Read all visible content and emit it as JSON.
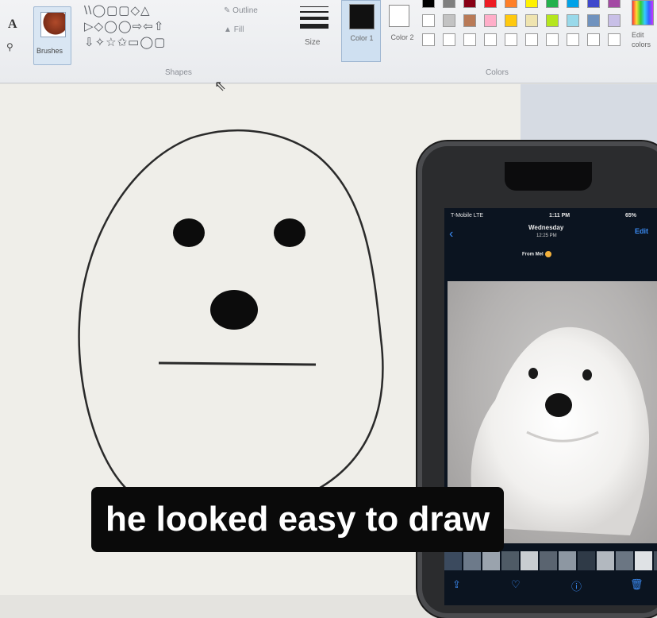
{
  "ribbon": {
    "brushes_label": "Brushes",
    "outline_label": "Outline",
    "fill_label": "Fill",
    "shapes_label": "Shapes",
    "size_label": "Size",
    "color1_label": "Color 1",
    "color2_label": "Color 2",
    "colors_label": "Colors",
    "edit_colors_label": "Edit colors",
    "shape_rows": [
      "\\\\◯▢▢◇△",
      "▷◇◯◯⇨⇦⇧",
      "⇩✧☆✩▭◯▢"
    ],
    "palette_row1": [
      "#000000",
      "#7f7f7f",
      "#880015",
      "#ed1c24",
      "#ff7f27",
      "#fff200",
      "#22b14c",
      "#00a2e8",
      "#3f48cc",
      "#a349a4"
    ],
    "palette_row2": [
      "#ffffff",
      "#c3c3c3",
      "#b97a57",
      "#ffaec9",
      "#ffc90e",
      "#efe4b0",
      "#b5e61d",
      "#99d9ea",
      "#7092be",
      "#c8bfe7"
    ],
    "palette_row3": [
      "#ffffff",
      "#ffffff",
      "#ffffff",
      "#ffffff",
      "#ffffff",
      "#ffffff",
      "#ffffff",
      "#ffffff",
      "#ffffff",
      "#ffffff"
    ],
    "color1": "#111111",
    "color2": "#ffffff"
  },
  "phone": {
    "carrier": "T-Mobile LTE",
    "time": "1:11 PM",
    "battery": "65%",
    "day": "Wednesday",
    "message_time": "12:25 PM",
    "edit_label": "Edit",
    "from_label": "From Mel"
  },
  "caption": "he looked easy to draw"
}
